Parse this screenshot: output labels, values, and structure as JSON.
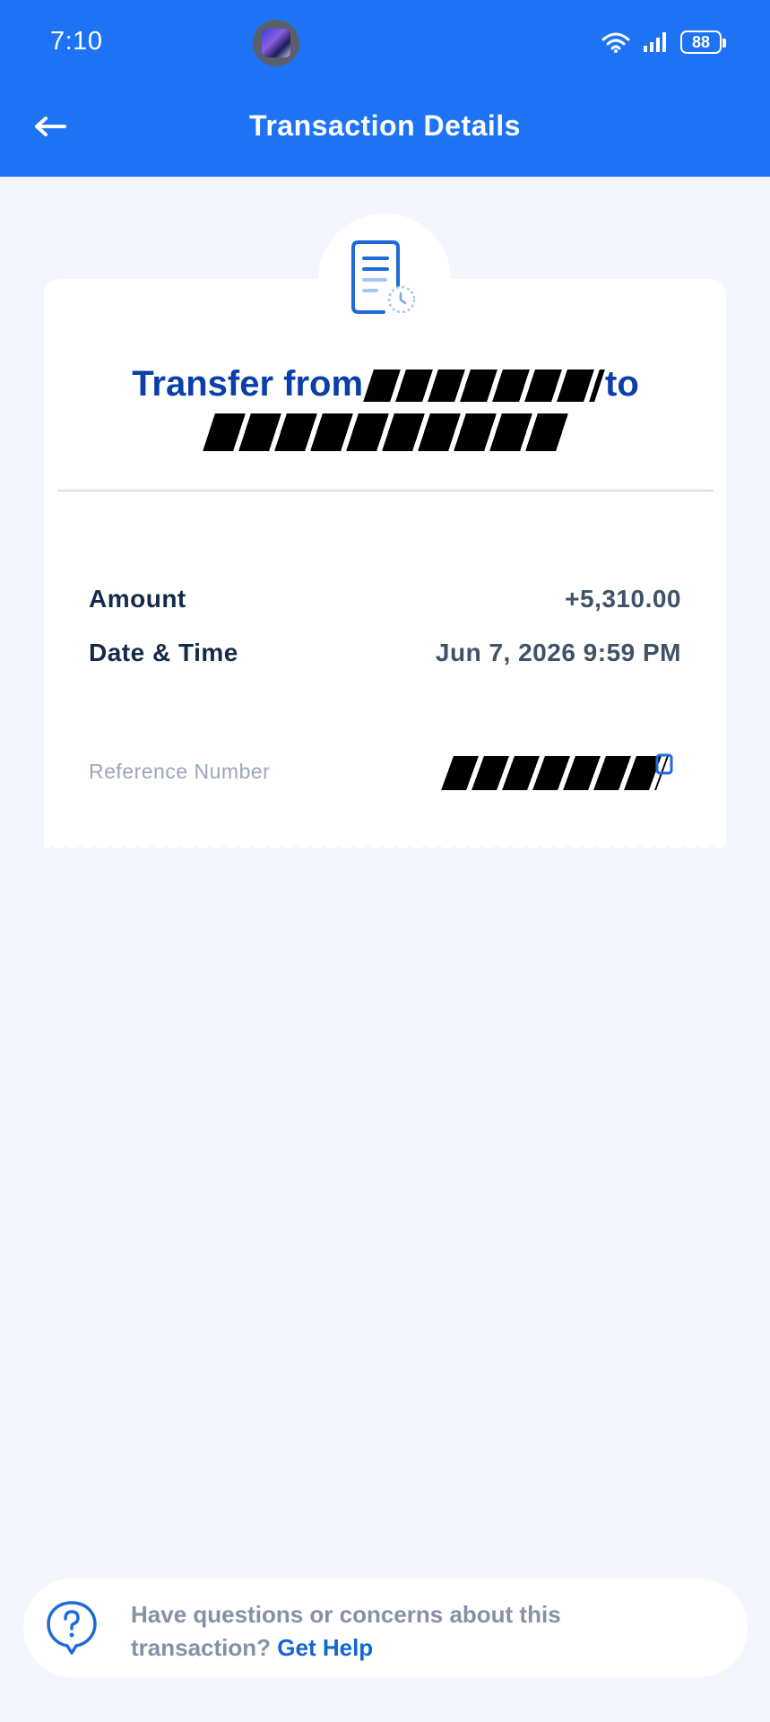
{
  "status_bar": {
    "time": "7:10",
    "battery": "88"
  },
  "header": {
    "title": "Transaction Details",
    "back_icon": "arrow-left-icon",
    "background": "#1e73f5"
  },
  "card": {
    "icon": "receipt-clock-icon",
    "transfer_prefix": "Transfer from",
    "transfer_middle": "to",
    "rows": [
      {
        "label": "Amount",
        "value": "+5,310.00"
      },
      {
        "label": "Date & Time",
        "value": "Jun 7, 2026 9:59 PM"
      }
    ],
    "reference_label": "Reference Number",
    "copy_icon": "copy-icon"
  },
  "help": {
    "icon": "question-bubble-icon",
    "text": "Have questions or concerns about this transaction?",
    "link": "Get Help"
  },
  "colors": {
    "accent": "#1e73f5",
    "title_blue": "#0a3ea8",
    "link_blue": "#1366d6",
    "page_bg": "#f3f7fd"
  }
}
